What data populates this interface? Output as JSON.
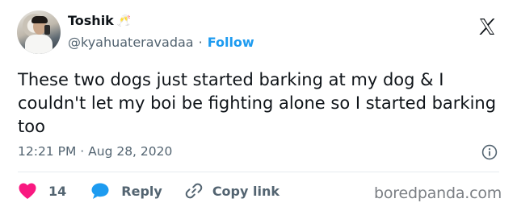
{
  "author": {
    "display_name": "Toshik",
    "name_emoji": "🥂",
    "handle": "@kyahuateravadaa",
    "separator": "·",
    "follow_label": "Follow"
  },
  "tweet": {
    "text": "These two dogs just started barking at my dog & I couldn't let my boi be fighting alone so I started barking too",
    "time": "12:21 PM",
    "date": "Aug 28, 2020",
    "meta_separator": "·"
  },
  "actions": {
    "like_count": "14",
    "reply_label": "Reply",
    "copy_link_label": "Copy link"
  },
  "colors": {
    "like": "#f91880",
    "reply": "#1d9bf0",
    "follow": "#1d9bf0",
    "muted": "#536471"
  },
  "icons": [
    "x-logo-icon",
    "info-icon",
    "heart-icon",
    "speech-bubble-icon",
    "link-icon"
  ],
  "watermark": "boredpanda.com"
}
